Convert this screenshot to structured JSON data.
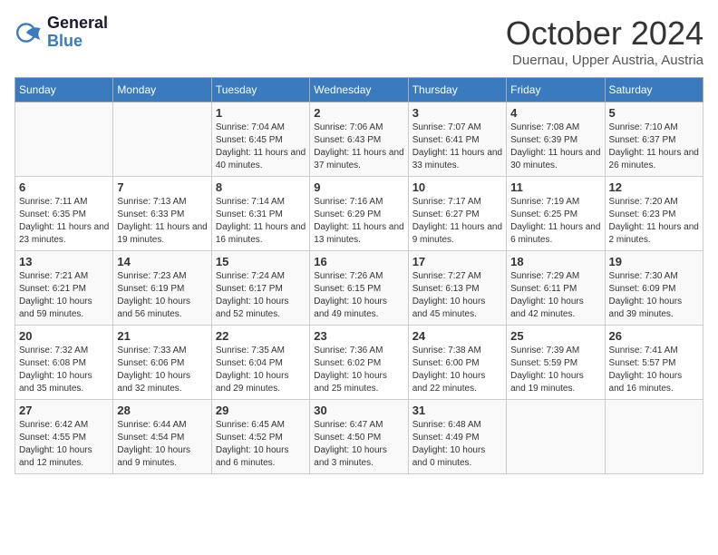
{
  "header": {
    "logo_line1": "General",
    "logo_line2": "Blue",
    "month_title": "October 2024",
    "location": "Duernau, Upper Austria, Austria"
  },
  "days_of_week": [
    "Sunday",
    "Monday",
    "Tuesday",
    "Wednesday",
    "Thursday",
    "Friday",
    "Saturday"
  ],
  "weeks": [
    [
      {
        "date": "",
        "sunrise": "",
        "sunset": "",
        "daylight": ""
      },
      {
        "date": "",
        "sunrise": "",
        "sunset": "",
        "daylight": ""
      },
      {
        "date": "1",
        "sunrise": "Sunrise: 7:04 AM",
        "sunset": "Sunset: 6:45 PM",
        "daylight": "Daylight: 11 hours and 40 minutes."
      },
      {
        "date": "2",
        "sunrise": "Sunrise: 7:06 AM",
        "sunset": "Sunset: 6:43 PM",
        "daylight": "Daylight: 11 hours and 37 minutes."
      },
      {
        "date": "3",
        "sunrise": "Sunrise: 7:07 AM",
        "sunset": "Sunset: 6:41 PM",
        "daylight": "Daylight: 11 hours and 33 minutes."
      },
      {
        "date": "4",
        "sunrise": "Sunrise: 7:08 AM",
        "sunset": "Sunset: 6:39 PM",
        "daylight": "Daylight: 11 hours and 30 minutes."
      },
      {
        "date": "5",
        "sunrise": "Sunrise: 7:10 AM",
        "sunset": "Sunset: 6:37 PM",
        "daylight": "Daylight: 11 hours and 26 minutes."
      }
    ],
    [
      {
        "date": "6",
        "sunrise": "Sunrise: 7:11 AM",
        "sunset": "Sunset: 6:35 PM",
        "daylight": "Daylight: 11 hours and 23 minutes."
      },
      {
        "date": "7",
        "sunrise": "Sunrise: 7:13 AM",
        "sunset": "Sunset: 6:33 PM",
        "daylight": "Daylight: 11 hours and 19 minutes."
      },
      {
        "date": "8",
        "sunrise": "Sunrise: 7:14 AM",
        "sunset": "Sunset: 6:31 PM",
        "daylight": "Daylight: 11 hours and 16 minutes."
      },
      {
        "date": "9",
        "sunrise": "Sunrise: 7:16 AM",
        "sunset": "Sunset: 6:29 PM",
        "daylight": "Daylight: 11 hours and 13 minutes."
      },
      {
        "date": "10",
        "sunrise": "Sunrise: 7:17 AM",
        "sunset": "Sunset: 6:27 PM",
        "daylight": "Daylight: 11 hours and 9 minutes."
      },
      {
        "date": "11",
        "sunrise": "Sunrise: 7:19 AM",
        "sunset": "Sunset: 6:25 PM",
        "daylight": "Daylight: 11 hours and 6 minutes."
      },
      {
        "date": "12",
        "sunrise": "Sunrise: 7:20 AM",
        "sunset": "Sunset: 6:23 PM",
        "daylight": "Daylight: 11 hours and 2 minutes."
      }
    ],
    [
      {
        "date": "13",
        "sunrise": "Sunrise: 7:21 AM",
        "sunset": "Sunset: 6:21 PM",
        "daylight": "Daylight: 10 hours and 59 minutes."
      },
      {
        "date": "14",
        "sunrise": "Sunrise: 7:23 AM",
        "sunset": "Sunset: 6:19 PM",
        "daylight": "Daylight: 10 hours and 56 minutes."
      },
      {
        "date": "15",
        "sunrise": "Sunrise: 7:24 AM",
        "sunset": "Sunset: 6:17 PM",
        "daylight": "Daylight: 10 hours and 52 minutes."
      },
      {
        "date": "16",
        "sunrise": "Sunrise: 7:26 AM",
        "sunset": "Sunset: 6:15 PM",
        "daylight": "Daylight: 10 hours and 49 minutes."
      },
      {
        "date": "17",
        "sunrise": "Sunrise: 7:27 AM",
        "sunset": "Sunset: 6:13 PM",
        "daylight": "Daylight: 10 hours and 45 minutes."
      },
      {
        "date": "18",
        "sunrise": "Sunrise: 7:29 AM",
        "sunset": "Sunset: 6:11 PM",
        "daylight": "Daylight: 10 hours and 42 minutes."
      },
      {
        "date": "19",
        "sunrise": "Sunrise: 7:30 AM",
        "sunset": "Sunset: 6:09 PM",
        "daylight": "Daylight: 10 hours and 39 minutes."
      }
    ],
    [
      {
        "date": "20",
        "sunrise": "Sunrise: 7:32 AM",
        "sunset": "Sunset: 6:08 PM",
        "daylight": "Daylight: 10 hours and 35 minutes."
      },
      {
        "date": "21",
        "sunrise": "Sunrise: 7:33 AM",
        "sunset": "Sunset: 6:06 PM",
        "daylight": "Daylight: 10 hours and 32 minutes."
      },
      {
        "date": "22",
        "sunrise": "Sunrise: 7:35 AM",
        "sunset": "Sunset: 6:04 PM",
        "daylight": "Daylight: 10 hours and 29 minutes."
      },
      {
        "date": "23",
        "sunrise": "Sunrise: 7:36 AM",
        "sunset": "Sunset: 6:02 PM",
        "daylight": "Daylight: 10 hours and 25 minutes."
      },
      {
        "date": "24",
        "sunrise": "Sunrise: 7:38 AM",
        "sunset": "Sunset: 6:00 PM",
        "daylight": "Daylight: 10 hours and 22 minutes."
      },
      {
        "date": "25",
        "sunrise": "Sunrise: 7:39 AM",
        "sunset": "Sunset: 5:59 PM",
        "daylight": "Daylight: 10 hours and 19 minutes."
      },
      {
        "date": "26",
        "sunrise": "Sunrise: 7:41 AM",
        "sunset": "Sunset: 5:57 PM",
        "daylight": "Daylight: 10 hours and 16 minutes."
      }
    ],
    [
      {
        "date": "27",
        "sunrise": "Sunrise: 6:42 AM",
        "sunset": "Sunset: 4:55 PM",
        "daylight": "Daylight: 10 hours and 12 minutes."
      },
      {
        "date": "28",
        "sunrise": "Sunrise: 6:44 AM",
        "sunset": "Sunset: 4:54 PM",
        "daylight": "Daylight: 10 hours and 9 minutes."
      },
      {
        "date": "29",
        "sunrise": "Sunrise: 6:45 AM",
        "sunset": "Sunset: 4:52 PM",
        "daylight": "Daylight: 10 hours and 6 minutes."
      },
      {
        "date": "30",
        "sunrise": "Sunrise: 6:47 AM",
        "sunset": "Sunset: 4:50 PM",
        "daylight": "Daylight: 10 hours and 3 minutes."
      },
      {
        "date": "31",
        "sunrise": "Sunrise: 6:48 AM",
        "sunset": "Sunset: 4:49 PM",
        "daylight": "Daylight: 10 hours and 0 minutes."
      },
      {
        "date": "",
        "sunrise": "",
        "sunset": "",
        "daylight": ""
      },
      {
        "date": "",
        "sunrise": "",
        "sunset": "",
        "daylight": ""
      }
    ]
  ]
}
